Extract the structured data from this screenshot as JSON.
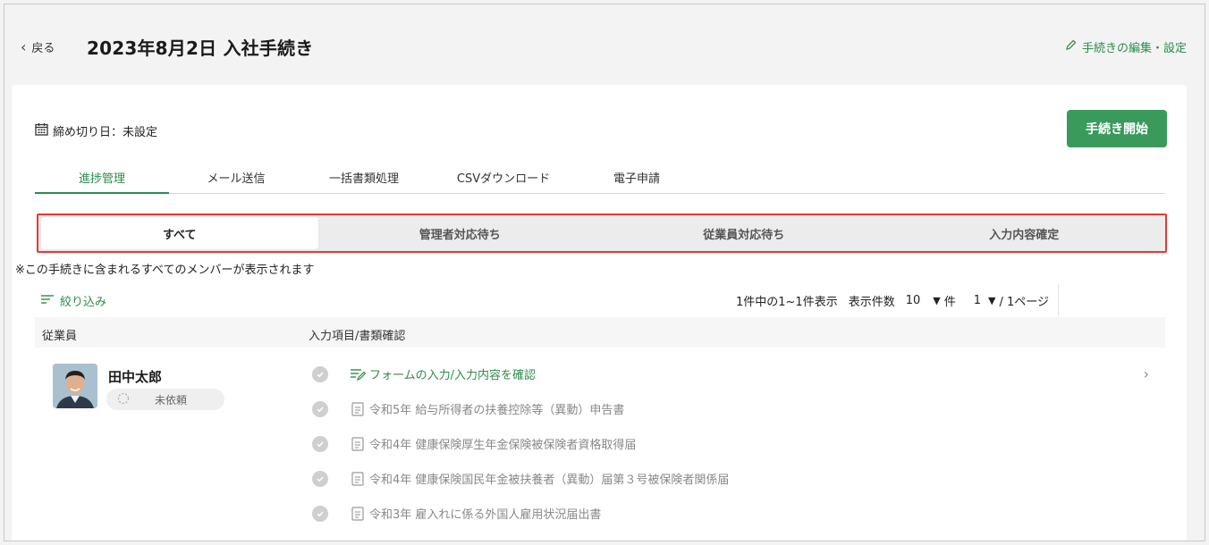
{
  "header": {
    "back_label": "戻る",
    "title": "2023年8月2日 入社手続き",
    "edit_label": "手続きの編集・設定"
  },
  "card": {
    "deadline_label": "締め切り日：未設定",
    "start_button": "手続き開始",
    "tabs": [
      {
        "label": "進捗管理",
        "active": true
      },
      {
        "label": "メール送信"
      },
      {
        "label": "一括書類処理"
      },
      {
        "label": "CSVダウンロード"
      },
      {
        "label": "電子申請"
      }
    ],
    "segments": [
      {
        "label": "すべて",
        "active": true
      },
      {
        "label": "管理者対応待ち"
      },
      {
        "label": "従業員対応待ち"
      },
      {
        "label": "入力内容確定"
      }
    ],
    "note": "※この手続きに含まれるすべてのメンバーが表示されます",
    "filter_label": "絞り込み",
    "pager": {
      "summary": "1件中の1~1件表示",
      "per_page_label": "表示件数",
      "per_page_value": "10",
      "per_page_unit": "件",
      "page_value": "1",
      "page_suffix": "/ 1ページ"
    },
    "table": {
      "col_employee": "従業員",
      "col_items": "入力項目/書類確認",
      "employee": {
        "name": "田中太郎",
        "status": "未依頼"
      },
      "items": [
        {
          "label": "フォームの入力/入力内容を確認",
          "icon": "form-edit-icon"
        },
        {
          "label": "令和5年 給与所得者の扶養控除等（異動）申告書",
          "icon": "document-icon"
        },
        {
          "label": "令和4年 健康保険厚生年金保険被保険者資格取得届",
          "icon": "document-icon"
        },
        {
          "label": "令和4年 健康保険国民年金被扶養者（異動）届第３号被保険者関係届",
          "icon": "document-icon"
        },
        {
          "label": "令和3年 雇入れに係る外国人雇用状況届出書",
          "icon": "document-icon"
        }
      ]
    }
  },
  "colors": {
    "accent": "#2e8b4b",
    "button": "#3a9a5c",
    "highlight_border": "#e53935"
  }
}
